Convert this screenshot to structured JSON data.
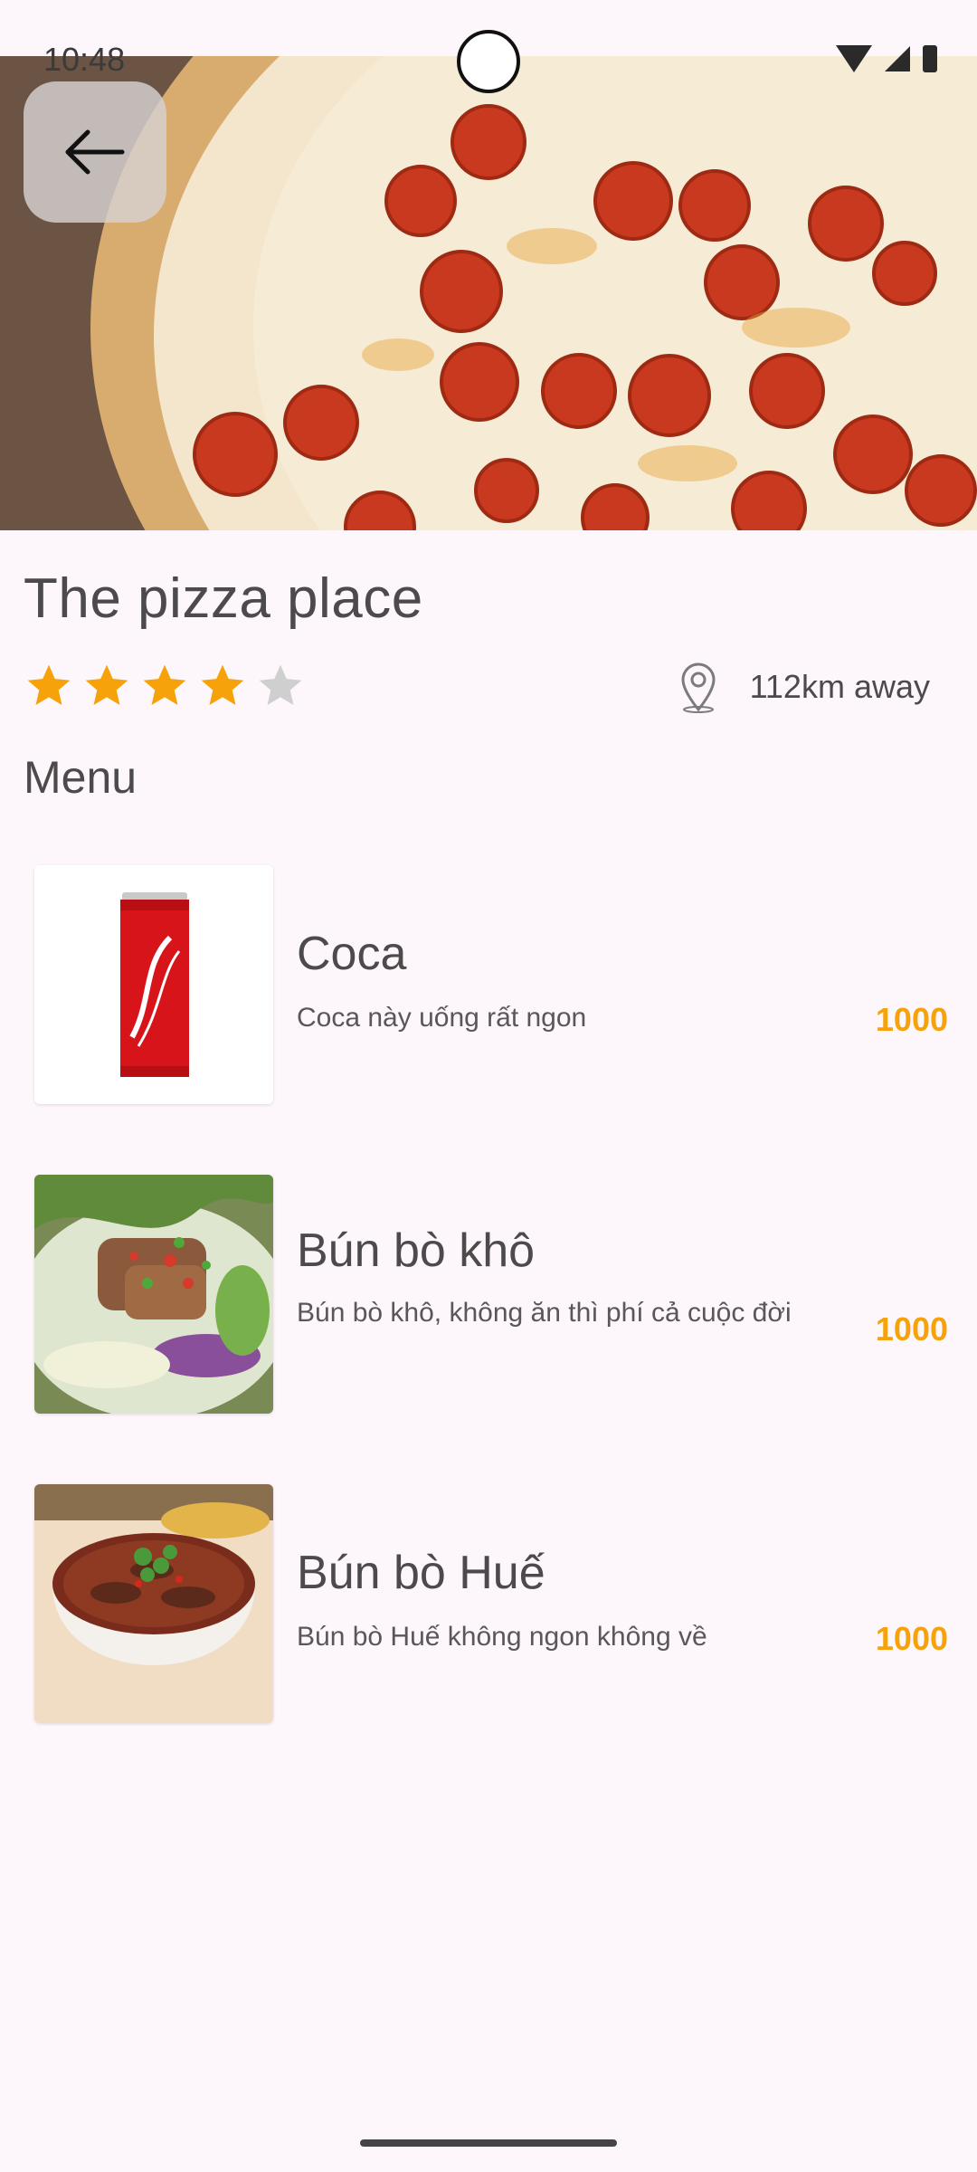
{
  "status_bar": {
    "time": "10:48"
  },
  "restaurant": {
    "name": "The pizza place",
    "rating": 4,
    "rating_max": 5,
    "distance": "112km away"
  },
  "menu": {
    "title": "Menu",
    "items": [
      {
        "name": "Coca",
        "description": "Coca này uống rất ngon",
        "price": "1000"
      },
      {
        "name": "Bún bò khô",
        "description": "Bún bò khô, không ăn thì phí cả cuộc đời",
        "price": "1000"
      },
      {
        "name": "Bún bò Huế",
        "description": "Bún bò Huế không ngon không về",
        "price": "1000"
      }
    ]
  },
  "colors": {
    "accent": "#f5a20b",
    "star_filled": "#f5a20b",
    "star_empty": "#cfcfcf",
    "background": "#fdf6fb"
  }
}
